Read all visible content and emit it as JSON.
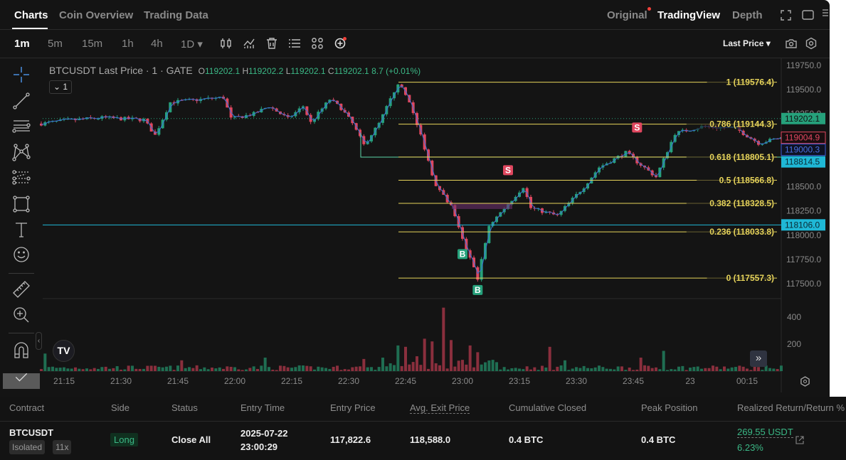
{
  "tabs": {
    "items": [
      "Charts",
      "Coin Overview",
      "Trading Data"
    ],
    "active": "Charts"
  },
  "view_modes": {
    "items": [
      "Original",
      "TradingView",
      "Depth"
    ],
    "active": "TradingView"
  },
  "timeframes": {
    "items": [
      "1m",
      "5m",
      "15m",
      "1h",
      "4h",
      "1D ▾"
    ],
    "active": "1m"
  },
  "toolbar": {
    "price_type": "Last Price ▾"
  },
  "legend": {
    "title": "BTCUSDT Last Price · 1 · GATE",
    "o_label": "O",
    "o": "119202.1",
    "h_label": "H",
    "h": "119202.2",
    "l_label": "L",
    "l": "119202.1",
    "c_label": "C",
    "c": "119202.1",
    "change": "8.7 (+0.01%)",
    "collapse": "⌄ 1"
  },
  "colors": {
    "up": "#26a17b",
    "down": "#e0475f",
    "fib": "#e6d35a",
    "cyan": "#1fb8d6",
    "ma": "#3b6fd6",
    "bg": "#141414"
  },
  "chart_data": {
    "type": "candlestick",
    "y_axis_ticks": [
      "119750.0",
      "119500.0",
      "119250.0",
      "119000.0",
      "118750.0",
      "118500.0",
      "118250.0",
      "118000.0",
      "117750.0",
      "117500.0"
    ],
    "ylim": [
      117500,
      119750
    ],
    "x_axis_ticks": [
      "21:15",
      "21:30",
      "21:45",
      "22:00",
      "22:15",
      "22:30",
      "22:45",
      "23:00",
      "23:15",
      "23:30",
      "23:45",
      "23",
      "00:15"
    ],
    "volume_ticks": [
      "400",
      "200"
    ],
    "price_path": [
      [
        "21:09",
        119150
      ],
      [
        "21:15",
        119180
      ],
      [
        "21:25",
        119210
      ],
      [
        "21:36",
        119190
      ],
      [
        "21:39",
        119030
      ],
      [
        "21:41",
        119200
      ],
      [
        "21:43",
        119370
      ],
      [
        "21:57",
        119420
      ],
      [
        "21:59",
        119200
      ],
      [
        "22:05",
        119250
      ],
      [
        "22:09",
        119330
      ],
      [
        "22:14",
        119200
      ],
      [
        "22:18",
        119330
      ],
      [
        "22:20",
        119160
      ],
      [
        "22:25",
        119400
      ],
      [
        "22:28",
        119310
      ],
      [
        "22:31",
        119150
      ],
      [
        "22:34",
        118930
      ],
      [
        "22:38",
        119150
      ],
      [
        "22:43",
        119570
      ],
      [
        "22:46",
        119380
      ],
      [
        "22:50",
        118900
      ],
      [
        "22:53",
        118500
      ],
      [
        "22:57",
        118300
      ],
      [
        "23:00",
        117950
      ],
      [
        "23:04",
        117560
      ],
      [
        "23:07",
        118100
      ],
      [
        "23:16",
        118500
      ],
      [
        "23:18",
        118280
      ],
      [
        "23:25",
        118200
      ],
      [
        "23:32",
        118500
      ],
      [
        "23:36",
        118700
      ],
      [
        "23:43",
        118850
      ],
      [
        "23:51",
        118600
      ],
      [
        "23:56",
        119050
      ],
      [
        "00:03",
        119120
      ],
      [
        "00:12",
        119100
      ],
      [
        "00:18",
        118950
      ],
      [
        "00:24",
        119005
      ]
    ],
    "volume_spikes": [
      [
        "21:10",
        130
      ],
      [
        "21:46",
        80
      ],
      [
        "22:08",
        100
      ],
      [
        "22:34",
        90
      ],
      [
        "22:39",
        100
      ],
      [
        "22:43",
        190
      ],
      [
        "22:45",
        180
      ],
      [
        "22:48",
        110
      ],
      [
        "22:50",
        240
      ],
      [
        "22:52",
        220
      ],
      [
        "22:55",
        470
      ],
      [
        "22:57",
        230
      ],
      [
        "23:02",
        190
      ],
      [
        "23:04",
        140
      ],
      [
        "23:23",
        180
      ],
      [
        "23:27",
        80
      ],
      [
        "23:47",
        100
      ],
      [
        "23:53",
        150
      ]
    ],
    "price_tags": [
      {
        "value": "119202.1",
        "style": "green"
      },
      {
        "value": "119004.9",
        "style": "red-outline"
      },
      {
        "value": "119000.3",
        "style": "blue-outline"
      },
      {
        "value": "118814.5",
        "style": "cyan"
      },
      {
        "value": "118106.0",
        "style": "cyan"
      }
    ],
    "fib_levels": [
      {
        "label": "1 (119576.4)",
        "price": 119576.4
      },
      {
        "label": "0.786 (119144.3)",
        "price": 119144.3
      },
      {
        "label": "0.618 (118805.1)",
        "price": 118805.1
      },
      {
        "label": "0.5 (118566.8)",
        "price": 118566.8
      },
      {
        "label": "0.382 (118328.5)",
        "price": 118328.5
      },
      {
        "label": "0.236 (118033.8)",
        "price": 118033.8
      },
      {
        "label": "0 (117557.3)",
        "price": 117557.3
      }
    ],
    "horizontal_line": 118106.0,
    "markers": [
      {
        "text": "S",
        "time": "23:12",
        "price": 118560
      },
      {
        "text": "S",
        "time": "23:46",
        "price": 119000
      },
      {
        "text": "B",
        "time": "23:00",
        "price": 117930
      },
      {
        "text": "B",
        "time": "23:04",
        "price": 117560
      }
    ]
  },
  "table": {
    "headers": [
      "Contract",
      "Side",
      "Status",
      "Entry Time",
      "Entry Price",
      "Avg. Exit Price",
      "Cumulative Closed",
      "Peak Position",
      "Realized Return/Return %"
    ],
    "row": {
      "contract": "BTCUSDT",
      "margin": "Isolated",
      "leverage": "11x",
      "side": "Long",
      "status": "Close All",
      "entry_date": "2025-07-22",
      "entry_clock": "23:00:29",
      "entry_price": "117,822.6",
      "avg_exit": "118,588.0",
      "cum_closed": "0.4 BTC",
      "peak": "0.4 BTC",
      "realized": "269.55 USDT",
      "return_pct": "6.23%"
    }
  }
}
